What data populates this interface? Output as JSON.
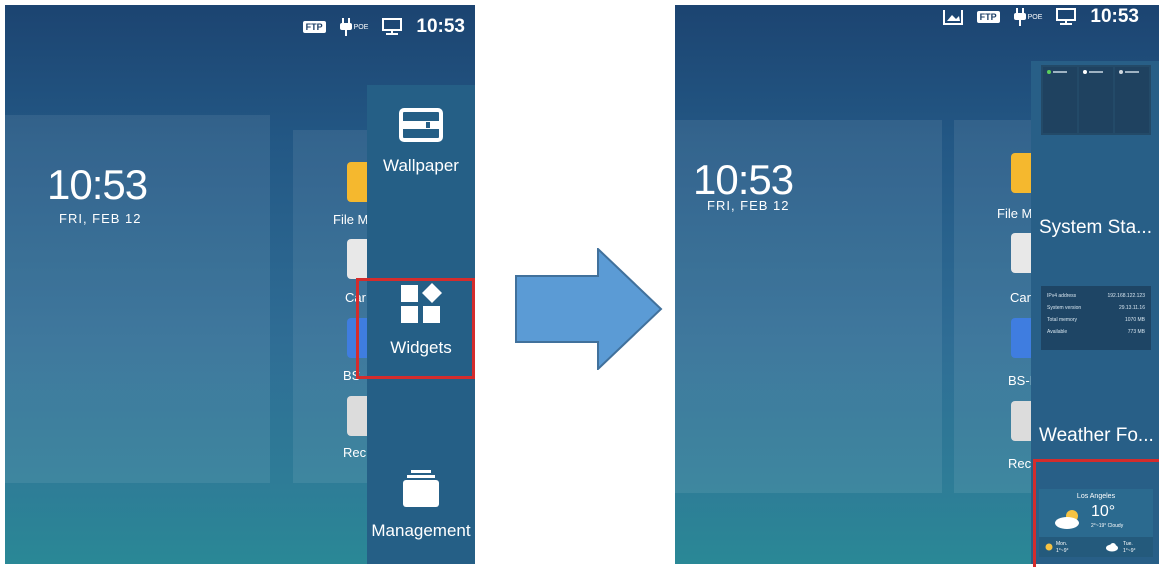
{
  "status_bar": {
    "ftp_label": "FTP",
    "poe_label": "POE",
    "time": "10:53"
  },
  "home": {
    "clock": "10:53",
    "date": "FRI, FEB 12"
  },
  "left": {
    "apps": [
      {
        "label": "File M",
        "color": "#f5b82e"
      },
      {
        "label": "Car",
        "color": "#e8e8e8"
      },
      {
        "label": "BS-",
        "color": "#3f7de0"
      },
      {
        "label": "Rec",
        "color": "#dcdcdc"
      }
    ],
    "menu": {
      "wallpaper": "Wallpaper",
      "widgets": "Widgets",
      "management": "Management"
    }
  },
  "right": {
    "apps": [
      {
        "label": "File M",
        "color": "#f5b82e"
      },
      {
        "label": "Car",
        "color": "#e8e8e8"
      },
      {
        "label": "BS-I",
        "color": "#3f7de0"
      },
      {
        "label": "Rec",
        "color": "#dcdcdc"
      }
    ],
    "widgets": {
      "system_status": "System Sta...",
      "weather_forecast": "Weather Fo...",
      "system_info_rows": [
        {
          "key": "IPv4 address",
          "value": "192.168.122.123"
        },
        {
          "key": "System version",
          "value": "29.13.11.16"
        },
        {
          "key": "Total memory",
          "value": "1070 MB"
        },
        {
          "key": "Available",
          "value": "773 MB"
        }
      ],
      "weather": {
        "city": "Los Angeles",
        "temp": "10°",
        "detail": "2°~19° Cloudy",
        "day1": "Mon.",
        "day1_temp": "1°~9°",
        "day2": "Tue.",
        "day2_temp": "1°~9°"
      }
    }
  },
  "colors": {
    "highlight": "#d42c2c",
    "arrow": "#5b9bd5",
    "arrow_border": "#41719c"
  }
}
